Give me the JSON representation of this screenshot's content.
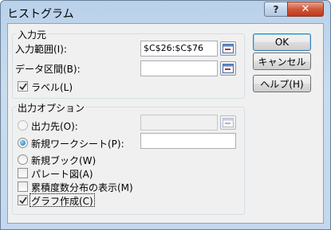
{
  "window": {
    "title": "ヒストグラム",
    "help_icon": "?",
    "close_icon": "✕"
  },
  "input_group": {
    "legend": "入力元",
    "input_range_label": "入力範囲(I):",
    "input_range_value": "$C$26:$C$76",
    "bin_range_label": "データ区間(B):",
    "bin_range_value": "",
    "labels_check": {
      "label": "ラベル(L)",
      "checked": true
    }
  },
  "output_group": {
    "legend": "出力オプション",
    "output_range": {
      "label": "出力先(O):",
      "selected": false,
      "value": ""
    },
    "new_worksheet": {
      "label": "新規ワークシート(P):",
      "selected": true,
      "value": ""
    },
    "new_workbook": {
      "label": "新規ブック(W)",
      "selected": false
    },
    "pareto": {
      "label": "パレート図(A)",
      "checked": false
    },
    "cumulative": {
      "label": "累積度数分布の表示(M)",
      "checked": false
    },
    "chart_output": {
      "label": "グラフ作成(C)",
      "checked": true
    }
  },
  "buttons": {
    "ok": "OK",
    "cancel": "キャンセル",
    "help": "ヘルプ(H)"
  },
  "icons": {
    "ref_button": "collapse-dialog-icon"
  }
}
